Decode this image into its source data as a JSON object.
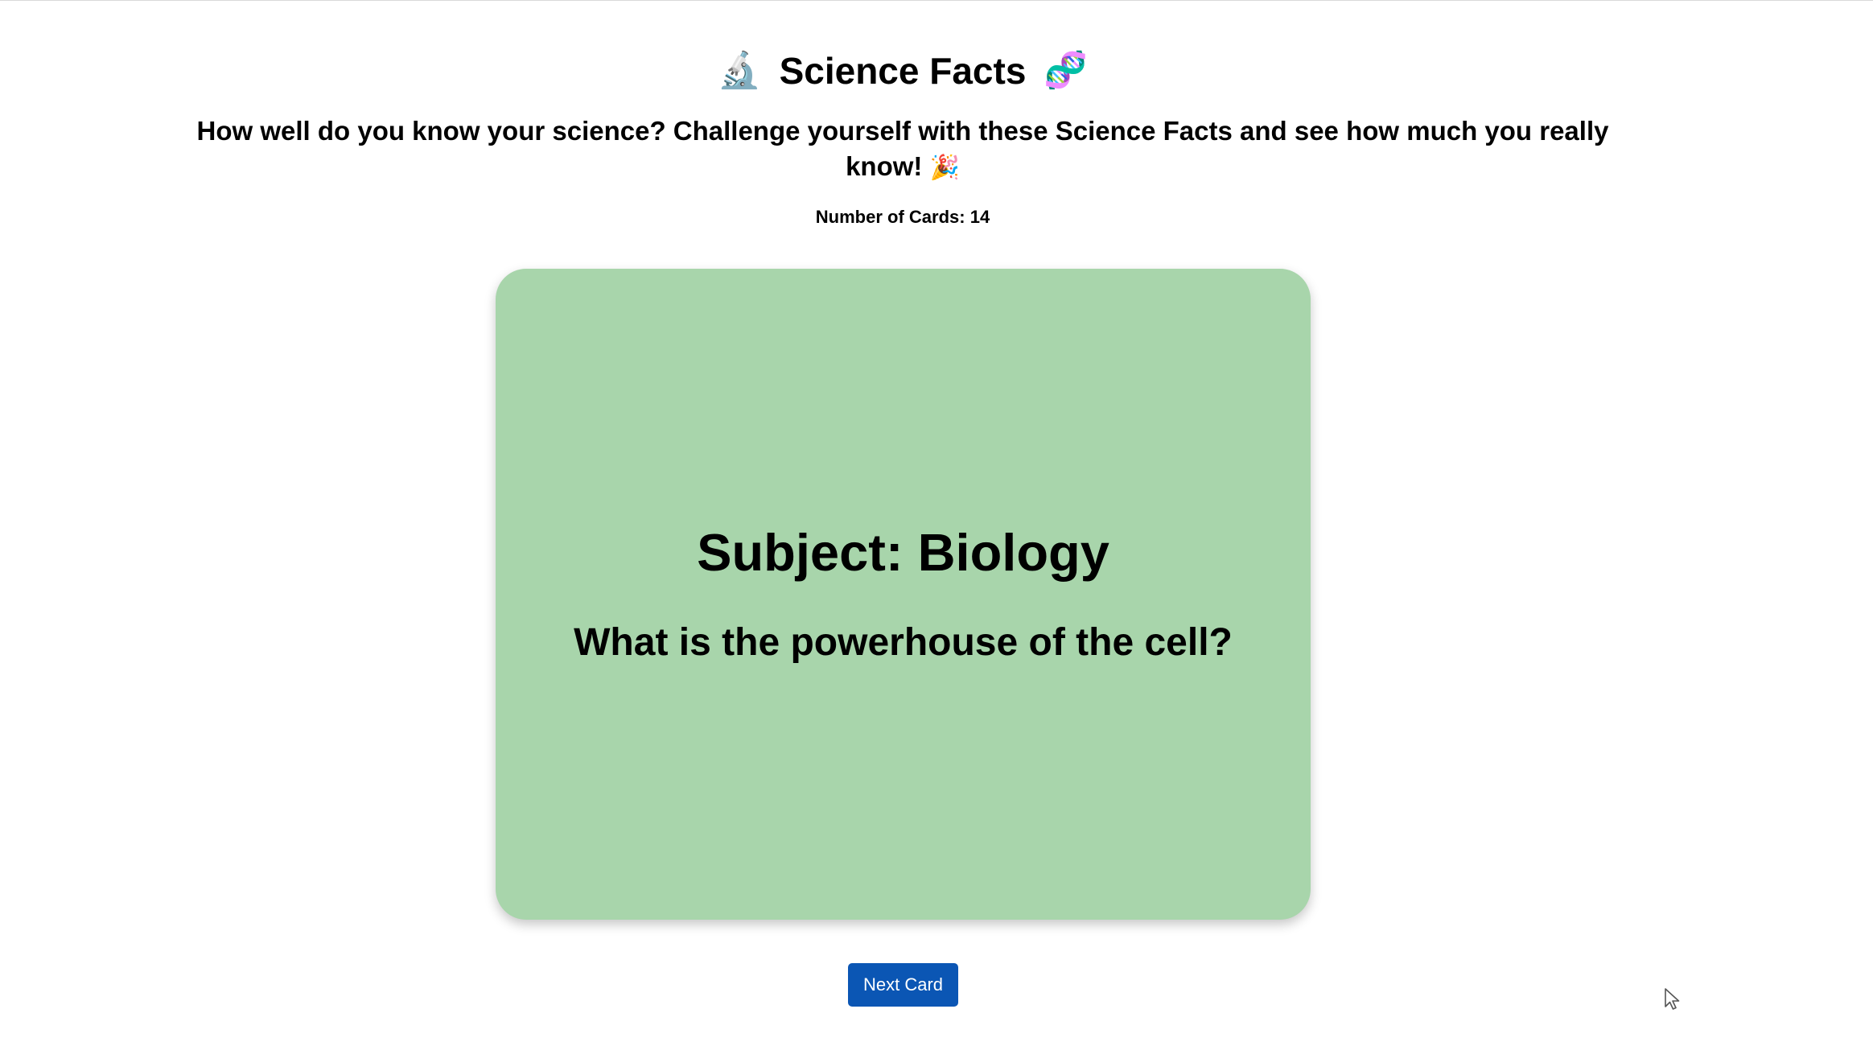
{
  "header": {
    "title_icon_left": "🔬",
    "title": "Science Facts",
    "title_icon_right": "🧬",
    "subtitle": "How well do you know your science? Challenge yourself with these Science Facts and see how much you really know!",
    "subtitle_icon": "🎉",
    "card_count_label": "Number of Cards: 14"
  },
  "card": {
    "subject": "Subject: Biology",
    "question": "What is the powerhouse of the cell?",
    "background_color": "#a8d5ab"
  },
  "controls": {
    "next_label": "Next Card",
    "button_color": "#0b56b4"
  },
  "icons": {
    "title_left": "microscope-icon",
    "title_right": "dna-icon",
    "subtitle": "party-popper-icon",
    "pointer": "mouse-cursor-icon"
  }
}
